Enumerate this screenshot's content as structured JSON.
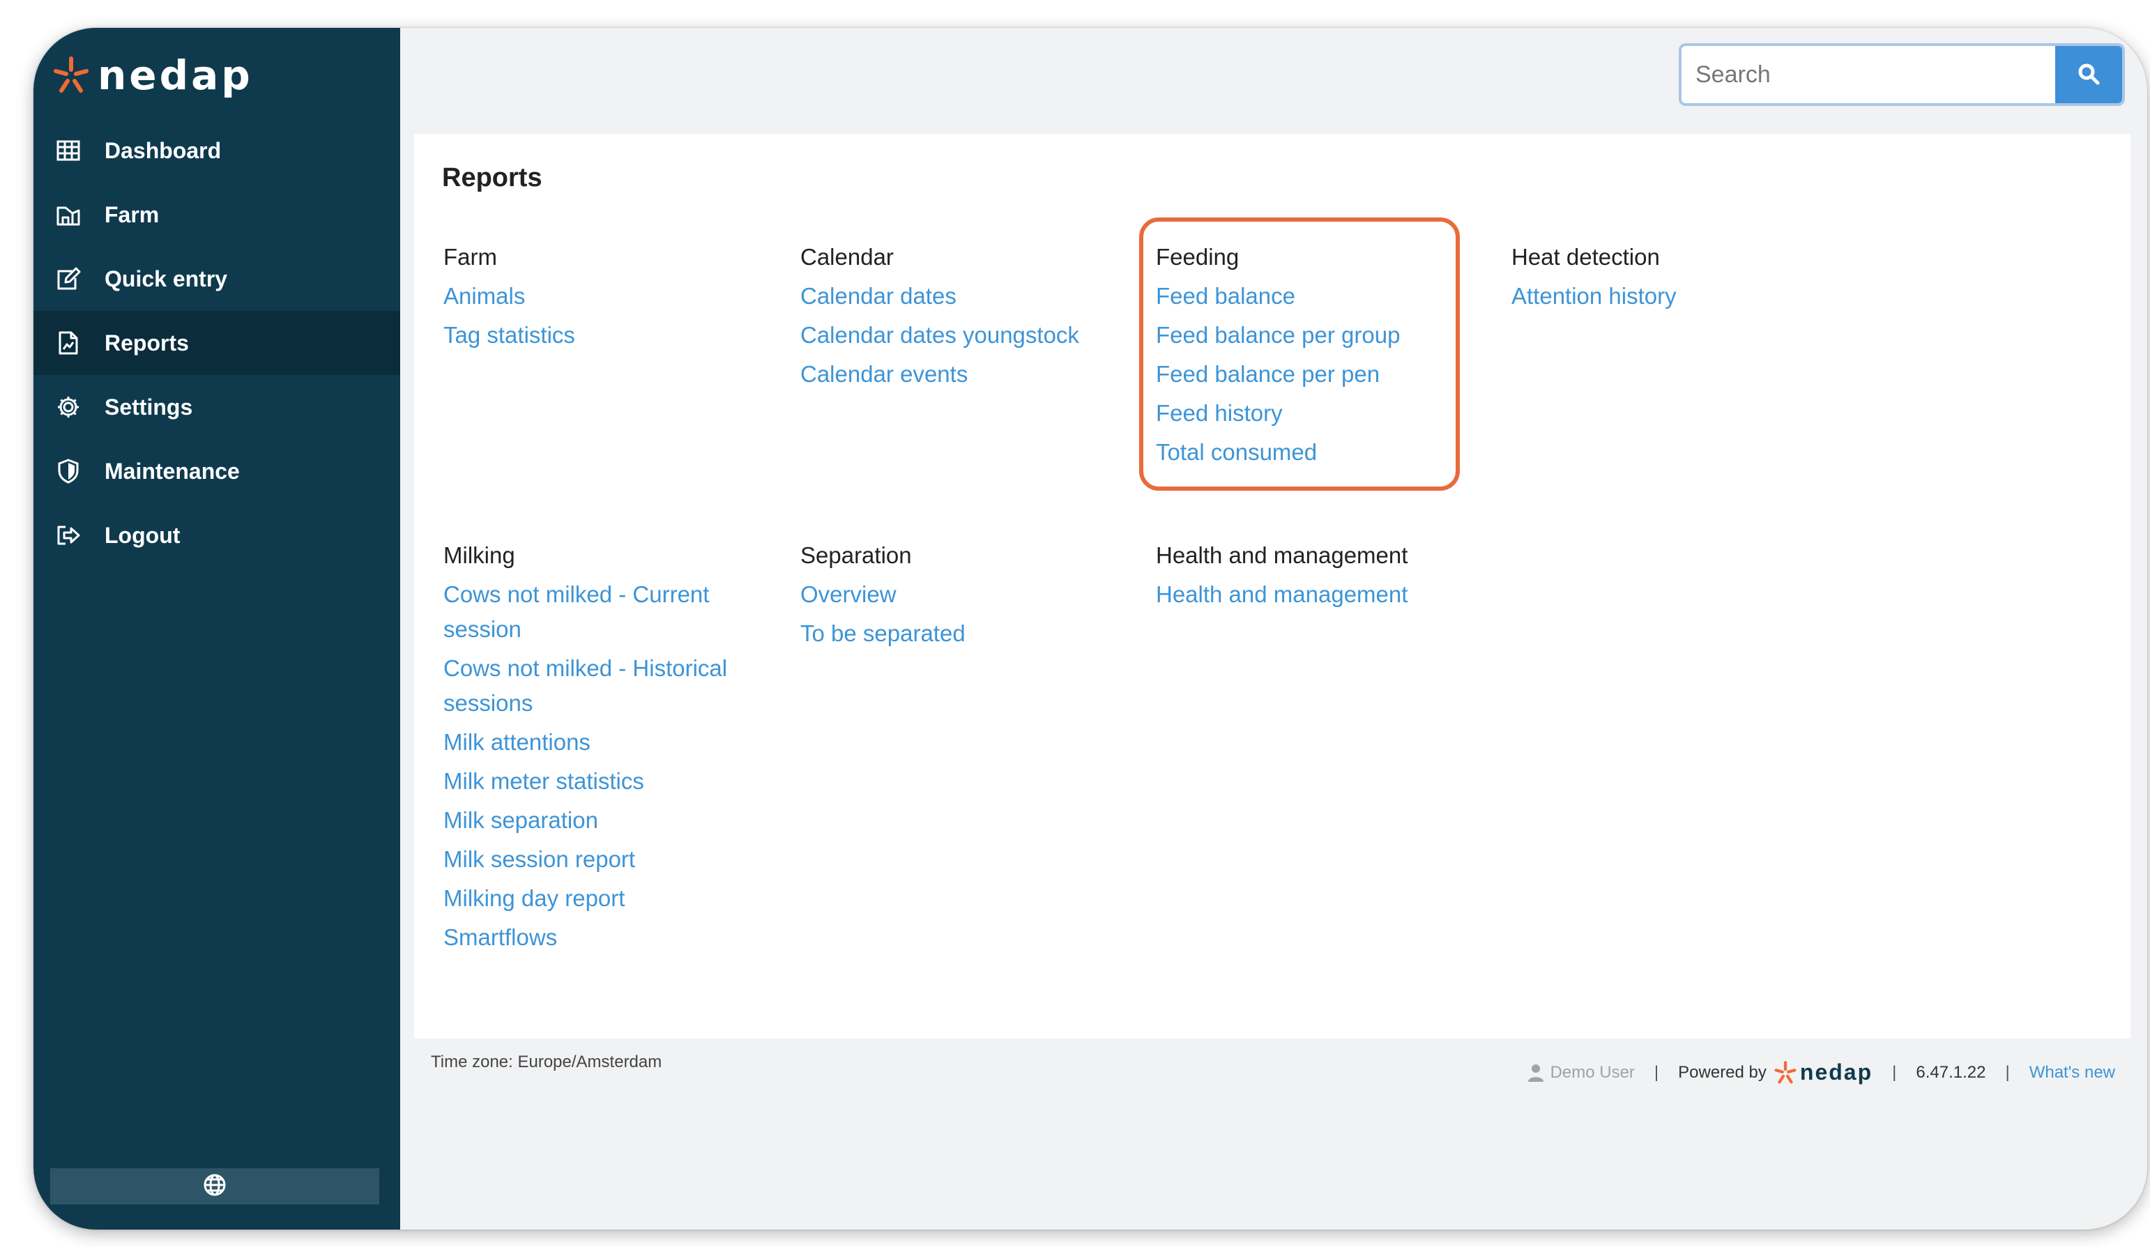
{
  "brand": {
    "name": "nedap",
    "accent": "#f06a37",
    "sidebar_bg": "#0f3a4d"
  },
  "sidebar": {
    "items": [
      {
        "label": "Dashboard",
        "icon": "grid-icon"
      },
      {
        "label": "Farm",
        "icon": "farm-icon"
      },
      {
        "label": "Quick entry",
        "icon": "edit-icon"
      },
      {
        "label": "Reports",
        "icon": "report-icon",
        "active": true
      },
      {
        "label": "Settings",
        "icon": "gear-icon"
      },
      {
        "label": "Maintenance",
        "icon": "shield-icon"
      },
      {
        "label": "Logout",
        "icon": "logout-icon"
      }
    ],
    "language_icon": "globe-icon"
  },
  "search": {
    "placeholder": "Search",
    "value": ""
  },
  "reports": {
    "title": "Reports",
    "groups": [
      {
        "heading": "Farm",
        "links": [
          "Animals",
          "Tag statistics"
        ]
      },
      {
        "heading": "Calendar",
        "links": [
          "Calendar dates",
          "Calendar dates youngstock",
          "Calendar events"
        ]
      },
      {
        "heading": "Feeding",
        "links": [
          "Feed balance",
          "Feed balance per group",
          "Feed balance per pen",
          "Feed history",
          "Total consumed"
        ],
        "highlighted": true
      },
      {
        "heading": "Heat detection",
        "links": [
          "Attention history"
        ]
      },
      {
        "heading": "Milking",
        "links": [
          "Cows not milked - Current session",
          "Cows not milked - Historical sessions",
          "Milk attentions",
          "Milk meter statistics",
          "Milk separation",
          "Milk session report",
          "Milking day report",
          "Smartflows"
        ]
      },
      {
        "heading": "Separation",
        "links": [
          "Overview",
          "To be separated"
        ]
      },
      {
        "heading": "Health and management",
        "links": [
          "Health and management"
        ]
      }
    ]
  },
  "footer": {
    "timezone": "Time zone: Europe/Amsterdam",
    "user": "Demo User",
    "powered_by": "Powered by",
    "powered_brand": "nedap",
    "version": "6.47.1.22",
    "whats_new": "What's new"
  }
}
